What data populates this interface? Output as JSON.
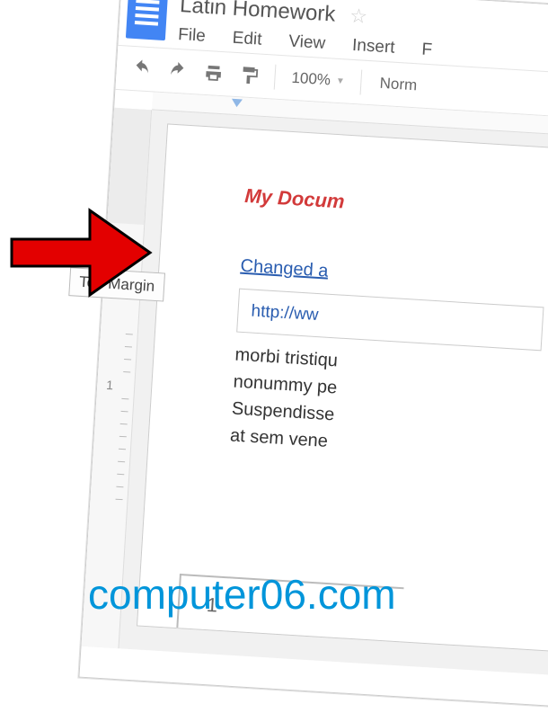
{
  "header": {
    "title": "Latin Homework"
  },
  "menubar": {
    "file": "File",
    "edit": "Edit",
    "view": "View",
    "insert": "Insert",
    "format": "F"
  },
  "toolbar": {
    "zoom": "100%",
    "style": "Norm"
  },
  "ruler": {
    "num1": "1"
  },
  "tooltip": {
    "label": "Top Margin"
  },
  "document": {
    "heading": "My Docum",
    "anchor": "Changed a",
    "url": "http://ww",
    "body1": "morbi tristiqu",
    "body2": "nonummy pe",
    "body3": "Suspendisse",
    "body4": "at sem vene"
  },
  "pagebar": {
    "num": "1"
  },
  "watermark": {
    "text": "computer06.com"
  }
}
